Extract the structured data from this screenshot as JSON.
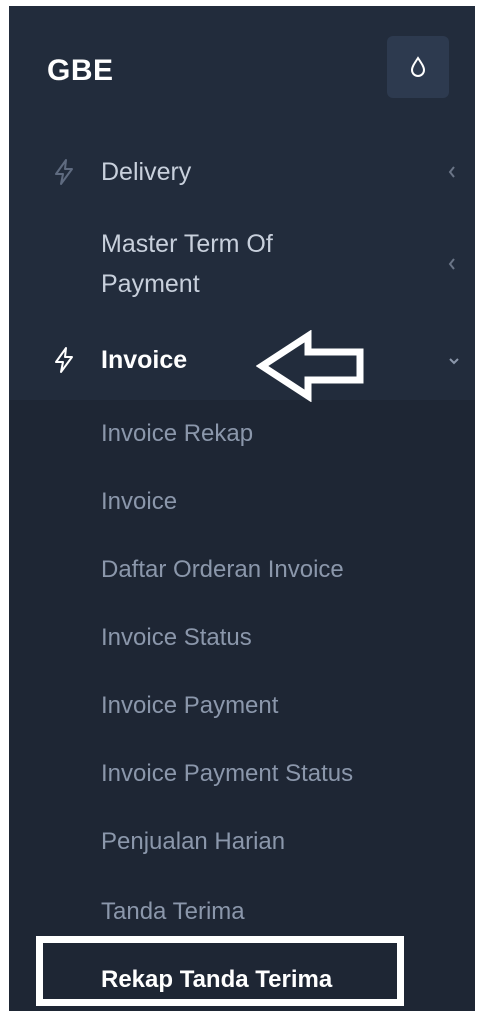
{
  "brand": {
    "title": "GBE",
    "toggle_icon": "droplet-icon"
  },
  "menu": {
    "items": [
      {
        "label": "Delivery",
        "icon": "bolt-icon",
        "chevron": "chevron-left-icon"
      },
      {
        "label_line1": "Master Term Of",
        "label_line2": "Payment",
        "chevron": "chevron-left-icon"
      },
      {
        "label": "Invoice",
        "icon": "bolt-icon",
        "chevron": "chevron-down-icon",
        "expanded": true
      }
    ],
    "submenu": [
      "Invoice Rekap",
      "Invoice",
      "Daftar Orderan Invoice",
      "Invoice Status",
      "Invoice Payment",
      "Invoice Payment Status",
      "Penjualan Harian",
      "Tanda Terima",
      "Rekap Tanda Terima"
    ],
    "selected_submenu": "Rekap Tanda Terima"
  },
  "annotation": {
    "arrow_icon": "pointer-arrow-left-icon",
    "highlight_color": "#ffffff"
  },
  "colors": {
    "sidebar_bg": "#1e2634",
    "header_bg": "#222c3c",
    "text": "#c8d0dc",
    "muted": "#8b97ab"
  }
}
